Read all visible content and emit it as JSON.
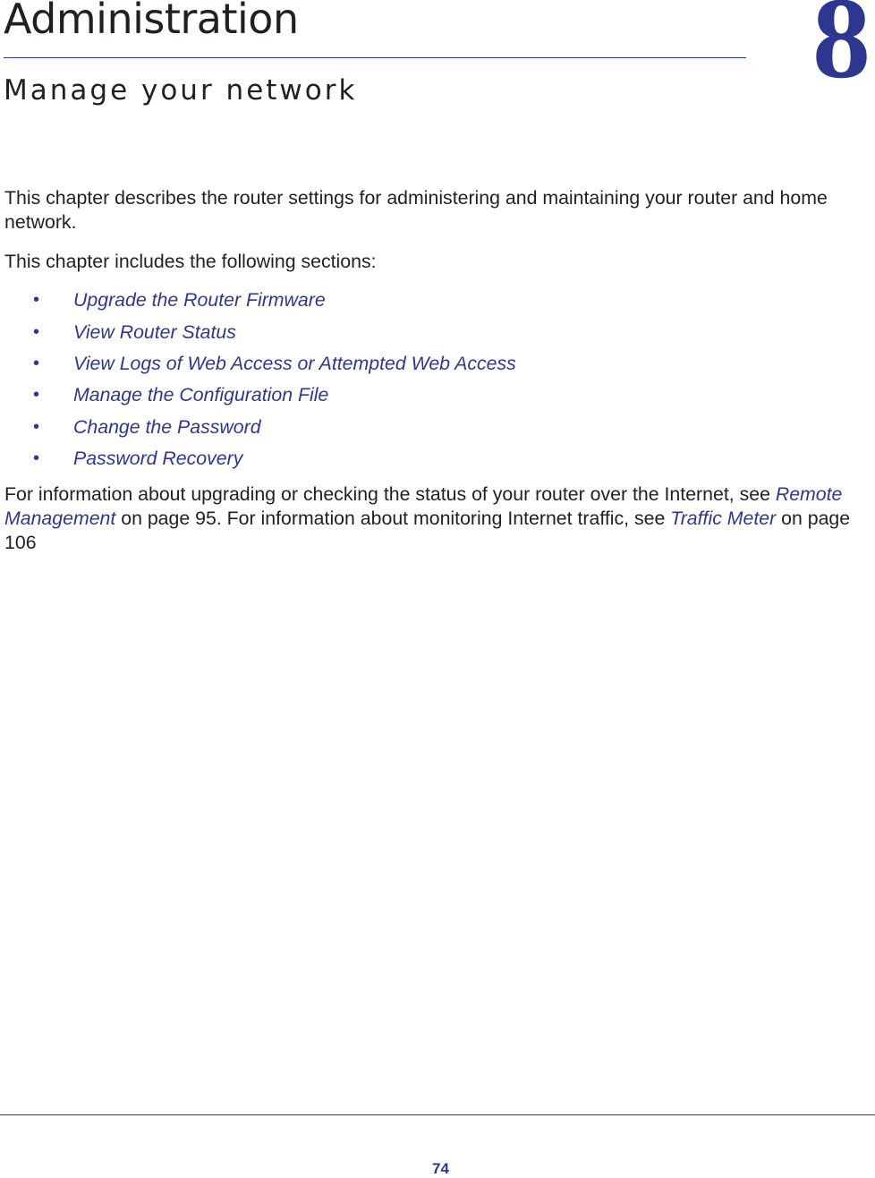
{
  "chapter": {
    "title": "Administration",
    "subtitle": "Manage your network",
    "number": "8"
  },
  "intro": {
    "paragraph1": "This chapter describes the router settings for administering and maintaining your router and home network.",
    "paragraph2": "This chapter includes the following sections:"
  },
  "sections": [
    {
      "bullet": "•",
      "label": "Upgrade the Router Firmware"
    },
    {
      "bullet": "•",
      "label": "View Router Status"
    },
    {
      "bullet": "•",
      "label": "View Logs of Web Access or Attempted Web Access"
    },
    {
      "bullet": "•",
      "label": "Manage the Configuration File"
    },
    {
      "bullet": "•",
      "label": "Change the Password"
    },
    {
      "bullet": "•",
      "label": "Password Recovery"
    }
  ],
  "more_info": {
    "text1": "For information about upgrading or checking the status of your router over the Internet, see ",
    "link1": "Remote Management",
    "text2": " on page 95. For information about monitoring Internet traffic, see ",
    "link2": "Traffic Meter",
    "text3": " on page 106"
  },
  "footer": {
    "page_number": "74"
  },
  "colors": {
    "accent": "#2e3790",
    "text": "#231f20"
  }
}
